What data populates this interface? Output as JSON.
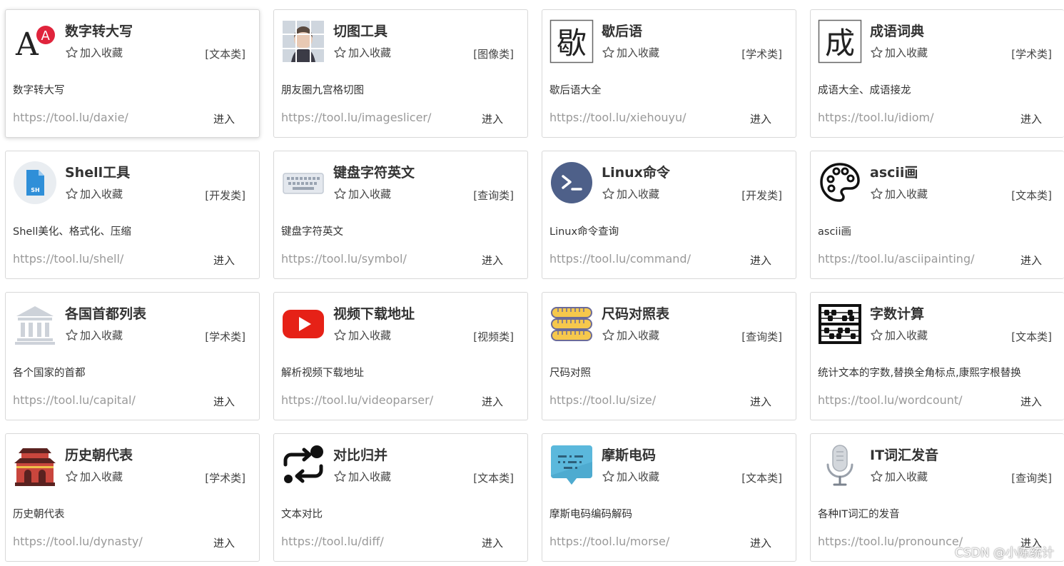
{
  "fav_label": "加入收藏",
  "watermark": "CSDN @小陈统计",
  "cards": [
    {
      "title": "数字转大写",
      "category": "[文本类]",
      "desc": "数字转大写",
      "url": "https://tool.lu/daxie/",
      "enter": "进入",
      "icon": "font-a-icon"
    },
    {
      "title": "切图工具",
      "category": "[图像类]",
      "desc": "朋友圈九宫格切图",
      "url": "https://tool.lu/imageslicer/",
      "enter": "进入",
      "icon": "photo-grid-icon"
    },
    {
      "title": "歇后语",
      "category": "[学术类]",
      "desc": "歇后语大全",
      "url": "https://tool.lu/xiehouyu/",
      "enter": "进入",
      "icon": "xie-char-icon",
      "glyph": "歇"
    },
    {
      "title": "成语词典",
      "category": "[学术类]",
      "desc": "成语大全、成语接龙",
      "url": "https://tool.lu/idiom/",
      "enter": "进入",
      "icon": "cheng-char-icon",
      "glyph": "成"
    },
    {
      "title": "Shell工具",
      "category": "[开发类]",
      "desc": "Shell美化、格式化、压缩",
      "url": "https://tool.lu/shell/",
      "enter": "进入",
      "icon": "shell-file-icon",
      "glyph": "SH"
    },
    {
      "title": "键盘字符英文",
      "category": "[查询类]",
      "desc": "键盘字符英文",
      "url": "https://tool.lu/symbol/",
      "enter": "进入",
      "icon": "keyboard-icon"
    },
    {
      "title": "Linux命令",
      "category": "[开发类]",
      "desc": "Linux命令查询",
      "url": "https://tool.lu/command/",
      "enter": "进入",
      "icon": "terminal-icon"
    },
    {
      "title": "ascii画",
      "category": "[文本类]",
      "desc": "ascii画",
      "url": "https://tool.lu/asciipainting/",
      "enter": "进入",
      "icon": "palette-icon"
    },
    {
      "title": "各国首都列表",
      "category": "[学术类]",
      "desc": "各个国家的首都",
      "url": "https://tool.lu/capital/",
      "enter": "进入",
      "icon": "capitol-building-icon"
    },
    {
      "title": "视频下载地址",
      "category": "[视频类]",
      "desc": "解析视频下载地址",
      "url": "https://tool.lu/videoparser/",
      "enter": "进入",
      "icon": "youtube-play-icon"
    },
    {
      "title": "尺码对照表",
      "category": "[查询类]",
      "desc": "尺码对照",
      "url": "https://tool.lu/size/",
      "enter": "进入",
      "icon": "tape-measure-icon"
    },
    {
      "title": "字数计算",
      "category": "[文本类]",
      "desc": "统计文本的字数,替换全角标点,康熙字根替换",
      "url": "https://tool.lu/wordcount/",
      "enter": "进入",
      "icon": "abacus-icon"
    },
    {
      "title": "历史朝代表",
      "category": "[学术类]",
      "desc": "历史朝代表",
      "url": "https://tool.lu/dynasty/",
      "enter": "进入",
      "icon": "palace-icon"
    },
    {
      "title": "对比归并",
      "category": "[文本类]",
      "desc": "文本对比",
      "url": "https://tool.lu/diff/",
      "enter": "进入",
      "icon": "diff-arrows-icon"
    },
    {
      "title": "摩斯电码",
      "category": "[文本类]",
      "desc": "摩斯电码编码解码",
      "url": "https://tool.lu/morse/",
      "enter": "进入",
      "icon": "morse-chat-icon"
    },
    {
      "title": "IT词汇发音",
      "category": "[查询类]",
      "desc": "各种IT词汇的发音",
      "url": "https://tool.lu/pronounce/",
      "enter": "进入",
      "icon": "microphone-icon"
    }
  ]
}
